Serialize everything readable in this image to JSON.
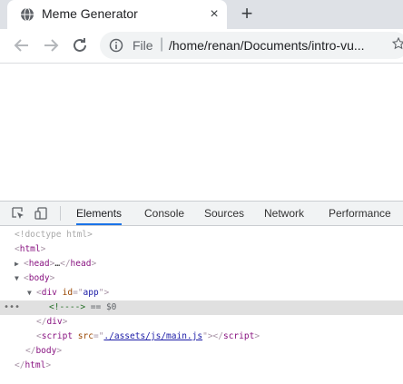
{
  "tab": {
    "title": "Meme Generator",
    "close_label": "×",
    "new_tab_label": "+"
  },
  "toolbar": {
    "scheme_label": "File",
    "separator": "|",
    "url": "/home/renan/Documents/intro-vu..."
  },
  "devtools": {
    "tabs": [
      "Elements",
      "Console",
      "Sources",
      "Network",
      "Performance"
    ],
    "active_tab": "Elements"
  },
  "dom": {
    "doctype": "<!doctype html>",
    "html_open": "html",
    "head": "head",
    "head_ellipsis": "…",
    "body_open": "body",
    "div_tag": "div",
    "div_attr_name": "id",
    "div_attr_value": "app",
    "comment": "<!---->",
    "eq": "== $0",
    "div_close": "div",
    "script_tag": "script",
    "script_attr_name": "src",
    "script_src": "./assets/js/main.js",
    "body_close": "body",
    "html_close": "html"
  },
  "colors": {
    "accent": "#1a73e8",
    "tag": "#881280",
    "attr_name": "#994500",
    "attr_value": "#1a1aa6",
    "comment": "#236e25"
  },
  "icons": [
    "globe-icon",
    "close-icon",
    "plus-icon",
    "back-arrow-icon",
    "forward-arrow-icon",
    "reload-icon",
    "info-icon",
    "star-icon",
    "inspect-element-icon",
    "device-toolbar-icon"
  ]
}
